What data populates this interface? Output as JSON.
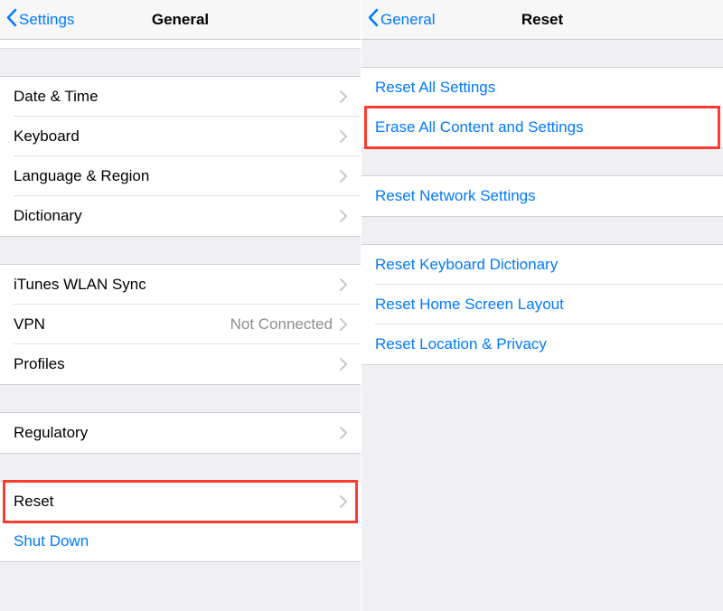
{
  "left": {
    "back_label": "Settings",
    "title": "General",
    "groups": {
      "g1": [
        {
          "label": "Date & Time"
        },
        {
          "label": "Keyboard"
        },
        {
          "label": "Language & Region"
        },
        {
          "label": "Dictionary"
        }
      ],
      "g2": [
        {
          "label": "iTunes WLAN Sync"
        },
        {
          "label": "VPN",
          "detail": "Not Connected"
        },
        {
          "label": "Profiles"
        }
      ],
      "g3": [
        {
          "label": "Regulatory"
        }
      ],
      "g4": [
        {
          "label": "Reset"
        },
        {
          "label": "Shut Down",
          "blue": true,
          "no_chevron": true
        }
      ]
    }
  },
  "right": {
    "back_label": "General",
    "title": "Reset",
    "groups": {
      "g1": [
        {
          "label": "Reset All Settings"
        },
        {
          "label": "Erase All Content and Settings"
        }
      ],
      "g2": [
        {
          "label": "Reset Network Settings"
        }
      ],
      "g3": [
        {
          "label": "Reset Keyboard Dictionary"
        },
        {
          "label": "Reset Home Screen Layout"
        },
        {
          "label": "Reset Location & Privacy"
        }
      ]
    }
  }
}
